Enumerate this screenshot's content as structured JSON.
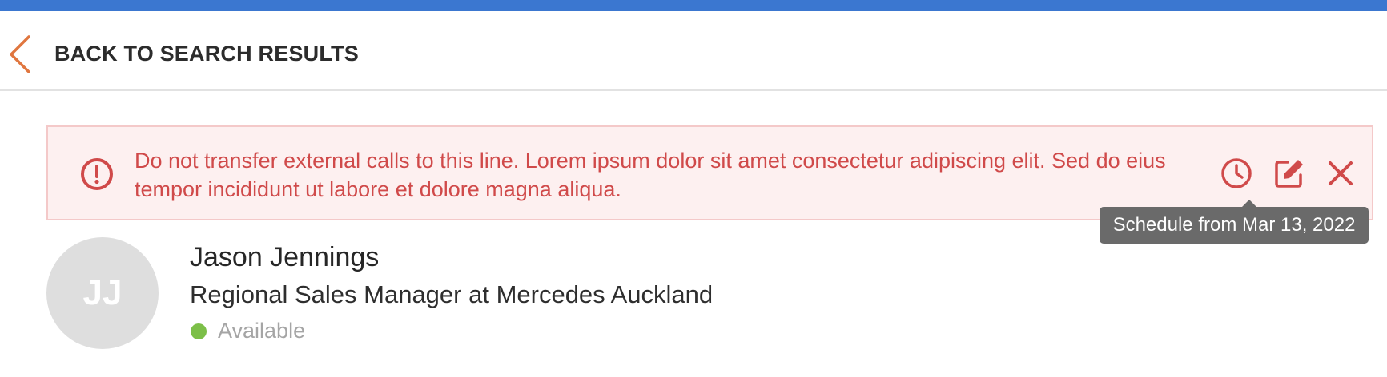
{
  "nav": {
    "back_label": "BACK TO SEARCH RESULTS"
  },
  "alert": {
    "message": "Do not transfer external calls to this line. Lorem ipsum dolor sit amet consectetur adipiscing elit. Sed do eius tempor incididunt ut labore et dolore magna aliqua.",
    "icon": "exclamation-circle-icon",
    "actions": [
      "clock-icon",
      "edit-icon",
      "close-icon"
    ],
    "tooltip": "Schedule from Mar 13, 2022"
  },
  "contact": {
    "initials": "JJ",
    "name": "Jason Jennings",
    "title": "Regional Sales Manager at Mercedes Auckland",
    "status": "Available"
  },
  "colors": {
    "top_bar": "#3b77d0",
    "accent_orange": "#e0763f",
    "alert_text": "#d04a4a",
    "alert_background": "#fdf0f0",
    "status_available": "#7cbf48"
  }
}
